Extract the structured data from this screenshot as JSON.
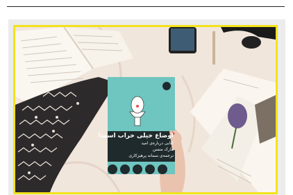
{
  "photo": {
    "subject": "book-on-bed-flatlay",
    "book": {
      "title": "اوضاع خیلی خراب است!",
      "subtitle": "کتابی درباره‌ی امید",
      "author": "مارک منسن",
      "translator": "ترجمه‌ی سمانه پرهیزکاری",
      "cover_color": "#6fc5c0",
      "band_color": "#1f2a2c"
    },
    "accent_frame_color": "#f3e21b"
  }
}
